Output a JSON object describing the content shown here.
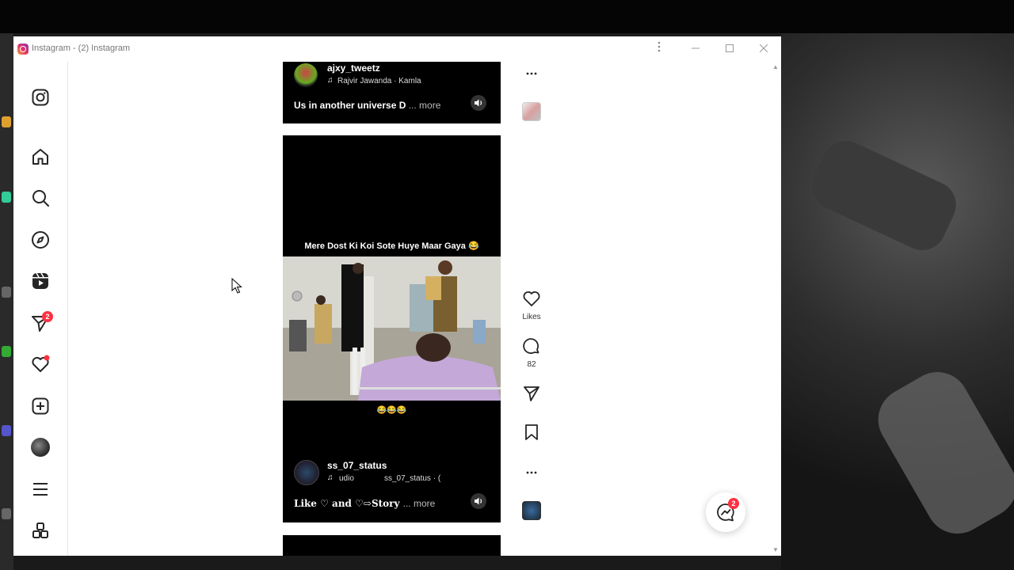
{
  "window": {
    "title": "Instagram - (2) Instagram"
  },
  "titlebar": {
    "menu_icon": "kebab-menu-icon",
    "minimize": "minimize-icon",
    "maximize": "maximize-icon",
    "close": "close-icon"
  },
  "sidebar": {
    "logo": "instagram-logo-icon",
    "items": [
      {
        "name": "home",
        "icon": "home-icon"
      },
      {
        "name": "search",
        "icon": "search-icon"
      },
      {
        "name": "explore",
        "icon": "compass-icon"
      },
      {
        "name": "reels",
        "icon": "reels-icon"
      },
      {
        "name": "messages",
        "icon": "send-icon",
        "badge": "2"
      },
      {
        "name": "notifications",
        "icon": "heart-icon"
      },
      {
        "name": "create",
        "icon": "plus-square-icon"
      },
      {
        "name": "profile",
        "icon": "avatar"
      },
      {
        "name": "more",
        "icon": "menu-icon"
      },
      {
        "name": "also-from-meta",
        "icon": "apps-icon"
      }
    ]
  },
  "reels": [
    {
      "username": "ajxy_tweetz",
      "audio": "Rajvir Jawanda · Kamla",
      "caption": "Us in another universe D",
      "more": "... more"
    },
    {
      "overlay_top": "Mere Dost Ki Koi Sote Huye Maar Gaya 😂",
      "overlay_bottom": "😂😂😂",
      "username": "ss_07_status",
      "audio": "udio",
      "audio_source": "ss_07_status · (",
      "caption": "Like ♡ and ♡⇨Story",
      "more": "... more"
    }
  ],
  "actions": {
    "likes_label": "Likes",
    "comments_count": "82"
  },
  "messages_fab": {
    "icon": "messenger-icon",
    "badge": "2"
  },
  "colors": {
    "accent": "#ff3040",
    "text": "#262626"
  }
}
